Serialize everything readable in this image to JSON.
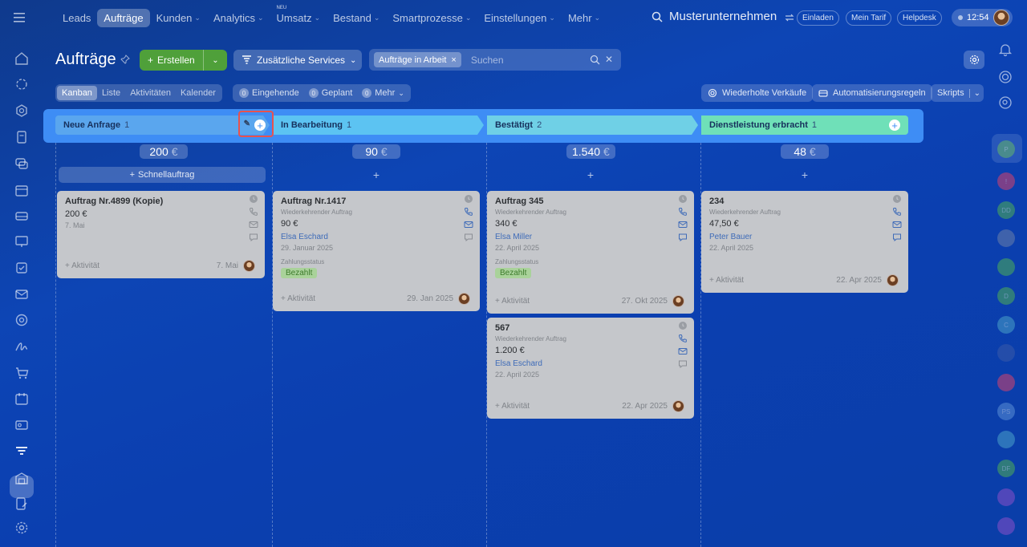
{
  "topnav": {
    "items": [
      {
        "label": "Leads",
        "chevron": false,
        "active": false
      },
      {
        "label": "Aufträge",
        "chevron": false,
        "active": true
      },
      {
        "label": "Kunden",
        "chevron": true,
        "active": false
      },
      {
        "label": "Analytics",
        "chevron": true,
        "active": false
      },
      {
        "label": "Umsatz",
        "chevron": true,
        "active": false,
        "badge": "NEU"
      },
      {
        "label": "Bestand",
        "chevron": true,
        "active": false
      },
      {
        "label": "Smartprozesse",
        "chevron": true,
        "active": false
      },
      {
        "label": "Einstellungen",
        "chevron": true,
        "active": false
      },
      {
        "label": "Mehr",
        "chevron": true,
        "active": false
      }
    ],
    "company": "Musterunternehmen",
    "invite": "Einladen",
    "plan": "Mein Tarif",
    "helpdesk": "Helpdesk",
    "time": "12:54"
  },
  "page": {
    "title": "Aufträge",
    "create_label": "Erstellen",
    "services_label": "Zusätzliche Services",
    "filter_chip": "Aufträge in Arbeit",
    "search_placeholder": "Suchen"
  },
  "toolbar": {
    "views": [
      "Kanban",
      "Liste",
      "Aktivitäten",
      "Kalender"
    ],
    "active_view": "Kanban",
    "counters": [
      {
        "count": "0",
        "label": "Eingehende"
      },
      {
        "count": "0",
        "label": "Geplant"
      },
      {
        "count": "0",
        "label": "Mehr"
      }
    ],
    "repeat_sales": "Wiederholte Verkäufe",
    "automation": "Automatisierungsregeln",
    "scripts": "Skripts"
  },
  "stages": [
    {
      "name": "Neue Anfrage",
      "count": "1",
      "sum": "200",
      "currency": "€",
      "color": "#5aa6ee"
    },
    {
      "name": "In Bearbeitung",
      "count": "1",
      "sum": "90",
      "currency": "€",
      "color": "#5cc3f2"
    },
    {
      "name": "Bestätigt",
      "count": "2",
      "sum": "1.540",
      "currency": "€",
      "color": "#6fd0e6"
    },
    {
      "name": "Dienstleistung erbracht",
      "count": "1",
      "sum": "48",
      "currency": "€",
      "color": "#6fe0b8"
    }
  ],
  "quick_order": "Schnellauftrag",
  "cards": [
    {
      "title": "Auftrag Nr.4899 (Kopie)",
      "amount": "200 €",
      "date": "7. Mai",
      "activity": "+ Aktivität",
      "foot_date": "7. Mai"
    },
    {
      "title": "Auftrag Nr.1417",
      "sub": "Wiederkehrender Auftrag",
      "amount": "90 €",
      "client": "Elsa Eschard",
      "date": "29. Januar 2025",
      "status_label": "Zahlungsstatus",
      "status": "Bezahlt",
      "activity": "+ Aktivität",
      "foot_date": "29. Jan 2025"
    },
    {
      "title": "Auftrag 345",
      "sub": "Wiederkehrender Auftrag",
      "amount": "340 €",
      "client": "Elsa Miller",
      "date": "22. April 2025",
      "status_label": "Zahlungsstatus",
      "status": "Bezahlt",
      "activity": "+ Aktivität",
      "foot_date": "27. Okt 2025"
    },
    {
      "title": "567",
      "sub": "Wiederkehrender Auftrag",
      "amount": "1.200 €",
      "client": "Elsa Eschard",
      "date": "22. April 2025",
      "activity": "+ Aktivität",
      "foot_date": "22. Apr 2025"
    },
    {
      "title": "234",
      "sub": "Wiederkehrender Auftrag",
      "amount": "47,50 €",
      "client": "Peter Bauer",
      "date": "22. April 2025",
      "activity": "+ Aktivität",
      "foot_date": "22. Apr 2025"
    }
  ],
  "right_rail": [
    {
      "text": "P",
      "color": "#4fae55"
    },
    {
      "text": "!",
      "color": "#d7426b"
    },
    {
      "text": "DD",
      "color": "#4fae55"
    },
    {
      "text": "",
      "color": "#6b7fa8"
    },
    {
      "text": "",
      "color": "#4fae55"
    },
    {
      "text": "D",
      "color": "#4fae55"
    },
    {
      "text": "C",
      "color": "#4aa0c8"
    },
    {
      "text": "",
      "color": "#3a5aa8"
    },
    {
      "text": "",
      "color": "#d7426b"
    },
    {
      "text": "PS",
      "color": "#5b8fd6"
    },
    {
      "text": "",
      "color": "#4aa0c8"
    },
    {
      "text": "DF",
      "color": "#4fae55"
    },
    {
      "text": "",
      "color": "#8a4fc8"
    },
    {
      "text": "",
      "color": "#8a4fc8"
    }
  ]
}
